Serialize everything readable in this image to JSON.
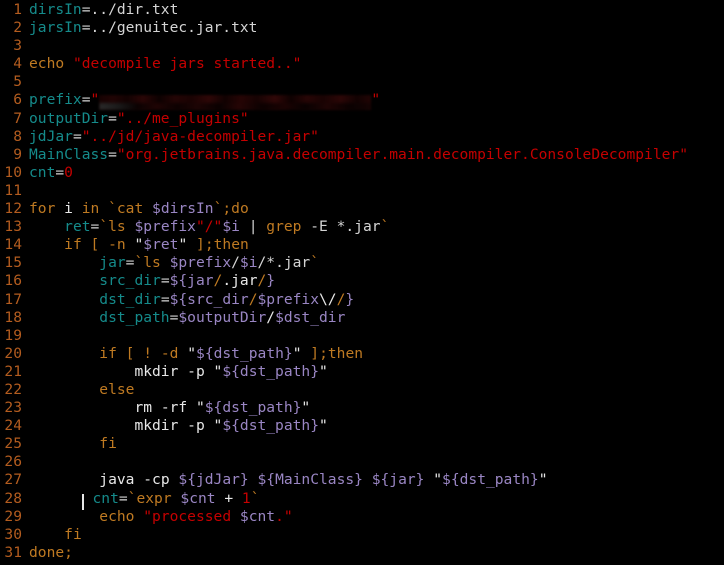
{
  "editor": {
    "background_color": "#000000",
    "gutter_color": "#b35c1f",
    "font_size_px": 14.6,
    "line_height_px": 18.1,
    "total_lines": 31,
    "cursor": {
      "line": 28,
      "column": 9,
      "color": "#e6e6e6",
      "shape": "vertical-bar"
    },
    "colors": {
      "identifier_teal": "#158b8b",
      "string_red": "#c50000",
      "keyword_orange": "#bf7a22",
      "expansion_purple": "#9a86c4",
      "normal_text": "#d4d4d4",
      "number_red": "#c50000",
      "line_number": "#b35c1f"
    }
  },
  "lines": [
    {
      "n": "1",
      "text": "dirsIn=../dir.txt"
    },
    {
      "n": "2",
      "text": "jarsIn=../genuitec.jar.txt"
    },
    {
      "n": "3",
      "text": ""
    },
    {
      "n": "4",
      "text": "echo \"decompile jars started..\""
    },
    {
      "n": "5",
      "text": ""
    },
    {
      "n": "6",
      "text": "prefix=\"████████████████████████████\"",
      "redacted": true
    },
    {
      "n": "7",
      "text": "outputDir=\"../me_plugins\""
    },
    {
      "n": "8",
      "text": "jdJar=\"../jd/java-decompiler.jar\""
    },
    {
      "n": "9",
      "text": "MainClass=\"org.jetbrains.java.decompiler.main.decompiler.ConsoleDecompiler\""
    },
    {
      "n": "10",
      "text": "cnt=0"
    },
    {
      "n": "11",
      "text": ""
    },
    {
      "n": "12",
      "text": "for i in `cat $dirsIn`;do"
    },
    {
      "n": "13",
      "text": "    ret=`ls $prefix\"/\"$i | grep -E *.jar`"
    },
    {
      "n": "14",
      "text": "    if [ -n \"$ret\" ];then"
    },
    {
      "n": "15",
      "text": "        jar=`ls $prefix/$i/*.jar`"
    },
    {
      "n": "16",
      "text": "        src_dir=${jar/.jar/}"
    },
    {
      "n": "17",
      "text": "        dst_dir=${src_dir/$prefix\\//}"
    },
    {
      "n": "18",
      "text": "        dst_path=$outputDir/$dst_dir"
    },
    {
      "n": "19",
      "text": ""
    },
    {
      "n": "20",
      "text": "        if [ ! -d \"${dst_path}\" ];then"
    },
    {
      "n": "21",
      "text": "            mkdir -p \"${dst_path}\""
    },
    {
      "n": "22",
      "text": "        else"
    },
    {
      "n": "23",
      "text": "            rm -rf \"${dst_path}\""
    },
    {
      "n": "24",
      "text": "            mkdir -p \"${dst_path}\""
    },
    {
      "n": "25",
      "text": "        fi"
    },
    {
      "n": "26",
      "text": ""
    },
    {
      "n": "27",
      "text": "        java -cp ${jdJar} ${MainClass} ${jar} \"${dst_path}\""
    },
    {
      "n": "28",
      "text": "        cnt=`expr $cnt + 1`"
    },
    {
      "n": "29",
      "text": "        echo \"processed $cnt.\""
    },
    {
      "n": "30",
      "text": "    fi"
    },
    {
      "n": "31",
      "text": "done;"
    }
  ]
}
